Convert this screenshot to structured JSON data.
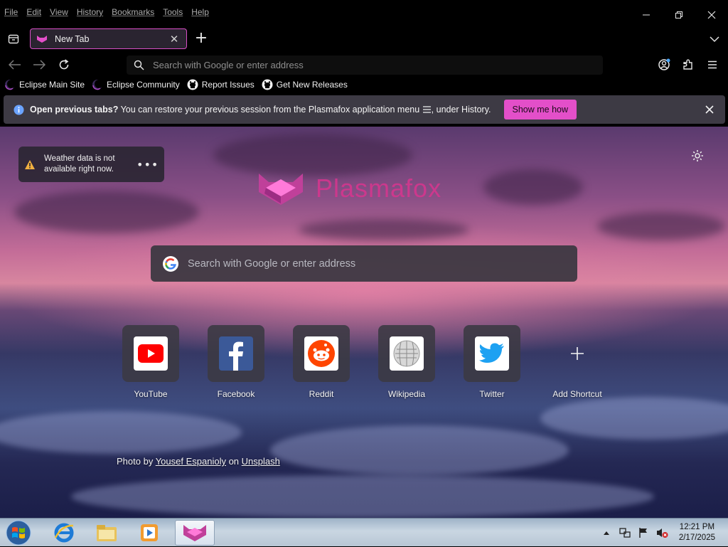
{
  "menu": [
    "File",
    "Edit",
    "View",
    "History",
    "Bookmarks",
    "Tools",
    "Help"
  ],
  "tab": {
    "title": "New Tab"
  },
  "navbar": {
    "url_placeholder": "Search with Google or enter address"
  },
  "bookmarks": [
    {
      "label": "Eclipse Main Site",
      "icon": "eclipse-icon"
    },
    {
      "label": "Eclipse Community",
      "icon": "eclipse-icon"
    },
    {
      "label": "Report Issues",
      "icon": "github-icon"
    },
    {
      "label": "Get New Releases",
      "icon": "github-icon"
    }
  ],
  "notice": {
    "bold": "Open previous tabs?",
    "text": " You can restore your previous session from the Plasmafox application menu ",
    "text_after": ", under History.",
    "button": "Show me how"
  },
  "newtab": {
    "weather": "Weather data is not available right now.",
    "logo_text": "Plasmafox",
    "search_placeholder": "Search with Google or enter address",
    "shortcuts": [
      {
        "label": "YouTube",
        "icon": "youtube-icon"
      },
      {
        "label": "Facebook",
        "icon": "facebook-icon"
      },
      {
        "label": "Reddit",
        "icon": "reddit-icon"
      },
      {
        "label": "Wikipedia",
        "icon": "wikipedia-icon"
      },
      {
        "label": "Twitter",
        "icon": "twitter-icon"
      },
      {
        "label": "Add Shortcut",
        "icon": "plus-icon"
      }
    ],
    "credit": {
      "prefix": "Photo by ",
      "author": "Yousef Espanioly",
      "mid": " on ",
      "site": "Unsplash"
    }
  },
  "taskbar": {
    "time": "12:21 PM",
    "date": "2/17/2025"
  },
  "colors": {
    "accent": "#e34fc9",
    "background": "#000000",
    "notice_bg": "#3d3a44"
  }
}
